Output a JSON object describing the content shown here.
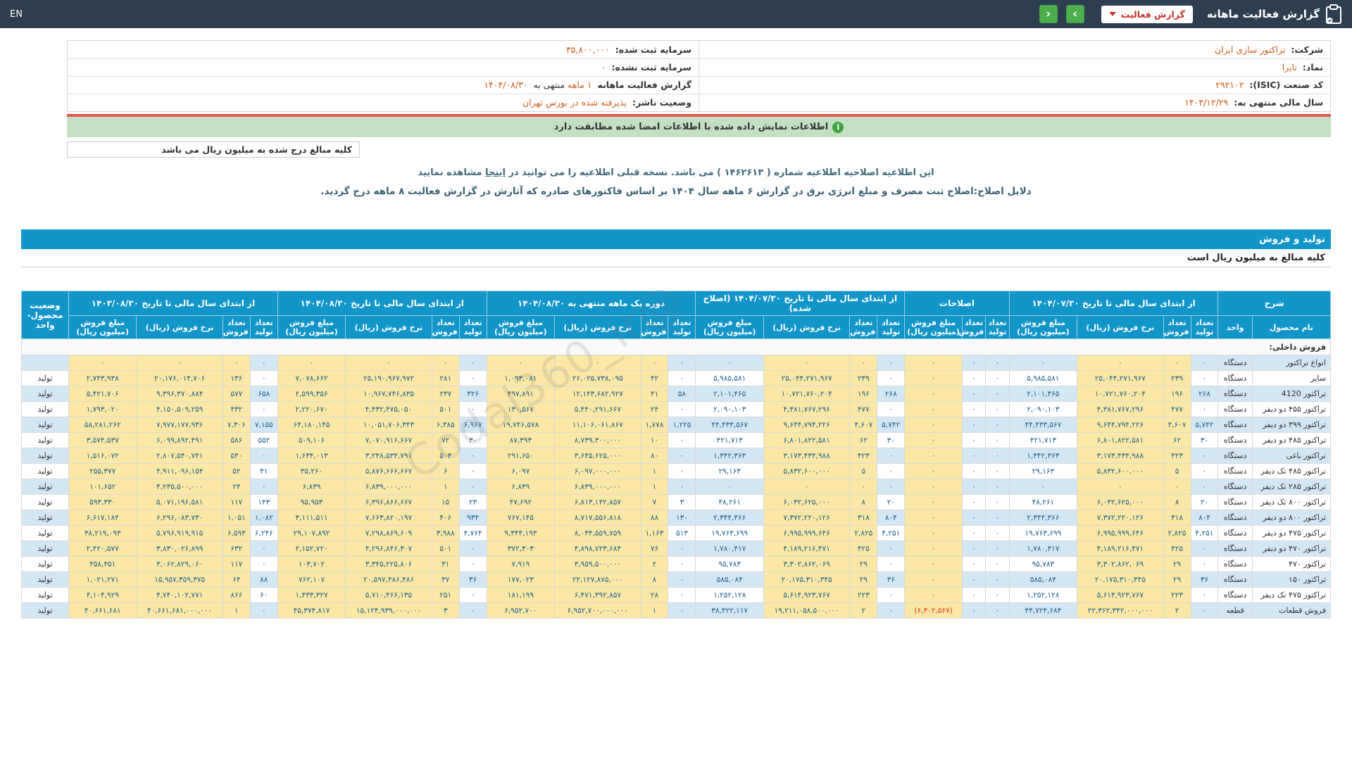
{
  "topbar": {
    "en": "EN",
    "title": "گزارش فعالیت ماهانه",
    "report_type": "گزارش فعالیت",
    "nav_prev": "‹",
    "nav_next": "›"
  },
  "info": {
    "right": [
      {
        "label": "شرکت:",
        "value": "تراکتور سازی ایران"
      },
      {
        "label": "نماد:",
        "value": "تایرا"
      },
      {
        "label": "کد صنعت (ISIC):",
        "value": "۲۹۲۱۰۲"
      },
      {
        "label": "سال مالی منتهی به:",
        "value": "۱۴۰۴/۱۲/۲۹"
      }
    ],
    "left": [
      {
        "label": "سرمایه ثبت شده:",
        "value": "۳۵,۸۰۰,۰۰۰"
      },
      {
        "label": "سرمایه ثبت نشده:",
        "value": "۰"
      },
      {
        "label": "گزارش فعالیت ماهانه",
        "value": "۱ ماهه",
        "suffix": "منتهی به",
        "value2": "۱۴۰۴/۰۸/۳۰"
      },
      {
        "label": "وضعیت ناشر:",
        "value": "پذیرفته شده در بورس تهران"
      }
    ]
  },
  "notice": "اطلاعات نمایش داده شده با اطلاعات امضا شده مطابقت دارد",
  "notice_icon": "i",
  "amounts_note": "کلیه مبالغ درج شده به میلیون ریال می باشد",
  "amendment_line": {
    "pre": "این اطلاعیه اصلاحیه اطلاعیه شماره ( ۱۴۶۲۶۱۳ ) می باشد. نسخه قبلی اطلاعیه را می توانید در",
    "link": "اینجا",
    "post": "مشاهده نمایید"
  },
  "reason_line": "دلایل اصلاح:اصلاح ثبت مصرف و مبلغ انرژی برق در گزارش ۶ ماهه سال ۱۴۰۴ بر اساس فاکتورهای صادره که آثارش در گزارش فعالیت ۸ ماهه درج گردید.",
  "section_bar": "تولید و فروش",
  "table_note": "کلیه مبالغ به میلیون ریال است",
  "watermark": "@Codal360_ir",
  "table": {
    "groups": [
      {
        "label": "شرح",
        "cols": 2
      },
      {
        "label": "از ابتدای سال مالی تا تاریخ ۱۴۰۴/۰۷/۳۰",
        "cols": 4
      },
      {
        "label": "اصلاحات",
        "cols": 3
      },
      {
        "label": "از ابتدای سال مالی تا تاریخ ۱۴۰۴/۰۷/۳۰ (اصلاح شده)",
        "cols": 4
      },
      {
        "label": "دوره یک ماهه منتهی به ۱۴۰۴/۰۸/۳۰",
        "cols": 4
      },
      {
        "label": "از ابتدای سال مالی تا تاریخ ۱۴۰۴/۰۸/۳۰",
        "cols": 4
      },
      {
        "label": "از ابتدای سال مالی تا تاریخ ۱۴۰۳/۰۸/۳۰",
        "cols": 4
      },
      {
        "label": "وضعیت محصول- واحد",
        "cols": 1,
        "rowspan": 2
      }
    ],
    "sub": {
      "name": "نام محصول",
      "unit": "واحد",
      "prod": "تعداد تولید",
      "sold": "تعداد فروش",
      "rate": "نرخ فروش (ریال)",
      "amount": "مبلغ فروش (میلیون ریال)"
    },
    "section_row": "فروش داخلی:",
    "rows": [
      {
        "name": "انواع تراکتور",
        "unit": "دستگاه",
        "status": "",
        "y1404_07": [
          "۰",
          "۰",
          "۰",
          "۰"
        ],
        "amend": [
          "۰",
          "۰",
          "۰"
        ],
        "corrected": [
          "۰",
          "۰",
          "۰",
          "۰"
        ],
        "month": [
          "۰",
          "۰",
          "۰",
          "۰"
        ],
        "y1404_08": [
          "۰",
          "۰",
          "۰",
          "۰"
        ],
        "y1403_08": [
          "۰",
          "۰",
          "۰",
          "۰"
        ]
      },
      {
        "name": "سایر",
        "unit": "دستگاه",
        "status": "تولید",
        "y1404_07": [
          "۰",
          "۲۳۹",
          "۲۵,۰۴۴,۲۷۱,۹۶۷",
          "۵,۹۸۵,۵۸۱"
        ],
        "amend": [
          "۰",
          "۰",
          "۰"
        ],
        "corrected": [
          "۰",
          "۲۳۹",
          "۲۵,۰۴۴,۲۷۱,۹۶۷",
          "۵,۹۸۵,۵۸۱"
        ],
        "month": [
          "۰",
          "۴۲",
          "۲۶,۰۲۵,۷۳۸,۰۹۵",
          "۱,۰۹۳,۰۸۱"
        ],
        "y1404_08": [
          "۰",
          "۲۸۱",
          "۲۵,۱۹۰,۹۶۷,۹۷۲",
          "۷,۰۷۸,۶۶۲"
        ],
        "y1403_08": [
          "۰",
          "۱۳۶",
          "۲۰,۱۷۶,۰۱۴,۷۰۶",
          "۲,۷۴۳,۹۳۸"
        ]
      },
      {
        "name": "تراکتور 4120",
        "unit": "دستگاه",
        "status": "تولید",
        "y1404_07": [
          "۲۶۸",
          "۱۹۶",
          "۱۰,۷۲۱,۷۶۰,۲۰۴",
          "۲,۱۰۱,۴۶۵"
        ],
        "amend": [
          "۰",
          "۰",
          "۰"
        ],
        "corrected": [
          "۲۶۸",
          "۱۹۶",
          "۱۰,۷۲۱,۷۶۰,۲۰۴",
          "۲,۱۰۱,۴۶۵"
        ],
        "month": [
          "۵۸",
          "۴۱",
          "۱۲,۱۴۳,۶۸۲,۹۲۷",
          "۴۹۷,۸۹۱"
        ],
        "y1404_08": [
          "۳۲۶",
          "۲۳۷",
          "۱۰,۹۶۷,۷۴۶,۸۳۵",
          "۲,۵۹۹,۳۵۶"
        ],
        "y1403_08": [
          "۶۵۸",
          "۵۷۷",
          "۹,۳۹۶,۳۷۰,۸۸۴",
          "۵,۴۲۱,۷۰۶"
        ]
      },
      {
        "name": "تراکتور ۴۵۵ دو دیفر",
        "unit": "دستگاه",
        "status": "تولید",
        "y1404_07": [
          "۰",
          "۴۷۷",
          "۴,۳۸۱,۷۶۷,۲۹۶",
          "۲,۰۹۰,۱۰۳"
        ],
        "amend": [
          "۰",
          "۰",
          "۰"
        ],
        "corrected": [
          "۰",
          "۴۷۷",
          "۴,۳۸۱,۷۶۷,۲۹۶",
          "۲,۰۹۰,۱۰۳"
        ],
        "month": [
          "۰",
          "۲۴",
          "۵,۴۴۰,۲۹۱,۶۶۷",
          "۱۳۰,۵۶۷"
        ],
        "y1404_08": [
          "۰",
          "۵۰۱",
          "۴,۴۳۲,۴۷۵,۰۵۰",
          "۲,۲۲۰,۶۷۰"
        ],
        "y1403_08": [
          "۰",
          "۴۳۲",
          "۴,۱۵۰,۵۰۹,۲۵۹",
          "۱,۷۹۳,۰۲۰"
        ]
      },
      {
        "name": "تراکتور ۳۹۹ دو دیفر",
        "unit": "دستگاه",
        "status": "تولید",
        "y1404_07": [
          "۵,۷۴۲",
          "۴,۶۰۷",
          "۹,۶۴۴,۷۹۴,۲۲۶",
          "۴۴,۴۳۳,۵۶۷"
        ],
        "amend": [
          "۰",
          "۰",
          "۰"
        ],
        "corrected": [
          "۵,۷۴۲",
          "۴,۶۰۷",
          "۹,۶۴۴,۷۹۴,۲۲۶",
          "۴۴,۴۳۳,۵۶۷"
        ],
        "month": [
          "۱,۲۲۵",
          "۱,۷۷۸",
          "۱۱,۱۰۶,۰۶۱,۸۶۷",
          "۱۹,۷۴۶,۵۷۸"
        ],
        "y1404_08": [
          "۶,۹۶۷",
          "۶,۳۸۵",
          "۱۰,۰۵۱,۷۰۶,۳۴۳",
          "۶۴,۱۸۰,۱۴۵"
        ],
        "y1403_08": [
          "۷,۱۵۵",
          "۷,۳۰۶",
          "۷,۹۷۷,۱۷۷,۹۳۶",
          "۵۸,۲۸۱,۲۶۲"
        ]
      },
      {
        "name": "تراکتور ۴۸۵ دو دیفر",
        "unit": "دستگاه",
        "status": "تولید",
        "y1404_07": [
          "۳۰",
          "۶۲",
          "۶,۸۰۱,۸۲۲,۵۸۱",
          "۴۲۱,۷۱۳"
        ],
        "amend": [
          "۰",
          "۰",
          "۰"
        ],
        "corrected": [
          "۳۰",
          "۶۲",
          "۶,۸۰۱,۸۲۲,۵۸۱",
          "۴۲۱,۷۱۳"
        ],
        "month": [
          "۰",
          "۱۰",
          "۸,۷۳۹,۳۰۰,۰۰۰",
          "۸۷,۳۹۳"
        ],
        "y1404_08": [
          "۳۰",
          "۷۲",
          "۷,۰۷۰,۹۱۶,۶۶۷",
          "۵۰۹,۱۰۶"
        ],
        "y1403_08": [
          "۵۵۲",
          "۵۸۶",
          "۶,۰۹۹,۸۹۲,۴۹۱",
          "۳,۵۷۴,۵۳۷"
        ]
      },
      {
        "name": "تراکتور باغی",
        "unit": "دستگاه",
        "status": "تولید",
        "y1404_07": [
          "۰",
          "۴۲۳",
          "۳,۱۷۳,۴۳۴,۹۸۸",
          "۱,۳۴۲,۳۶۳"
        ],
        "amend": [
          "۰",
          "۰",
          "۰"
        ],
        "corrected": [
          "۰",
          "۴۲۳",
          "۳,۱۷۳,۴۳۴,۹۸۸",
          "۱,۳۴۲,۳۶۳"
        ],
        "month": [
          "۰",
          "۸۰",
          "۳,۶۴۵,۶۲۵,۰۰۰",
          "۲۹۱,۶۵۰"
        ],
        "y1404_08": [
          "۰",
          "۵۰۳",
          "۳,۲۴۸,۵۳۴,۷۹۱",
          "۱,۶۳۴,۰۱۳"
        ],
        "y1403_08": [
          "۰",
          "۵۴۰",
          "۲,۸۰۷,۵۴۰,۷۴۱",
          "۱,۵۱۶,۰۷۲"
        ]
      },
      {
        "name": "تراکتور ۴۸۵ تک دیفر",
        "unit": "دستگاه",
        "status": "تولید",
        "y1404_07": [
          "۰",
          "۵",
          "۵,۸۳۲,۶۰۰,۰۰۰",
          "۲۹,۱۶۳"
        ],
        "amend": [
          "۰",
          "۰",
          "۰"
        ],
        "corrected": [
          "۰",
          "۵",
          "۵,۸۳۲,۶۰۰,۰۰۰",
          "۲۹,۱۶۳"
        ],
        "month": [
          "۰",
          "۱",
          "۶,۰۹۷,۰۰۰,۰۰۰",
          "۶,۰۹۷"
        ],
        "y1404_08": [
          "۰",
          "۶",
          "۵,۸۷۶,۶۶۶,۶۶۷",
          "۳۵,۲۶۰"
        ],
        "y1403_08": [
          "۴۱",
          "۵۲",
          "۴,۹۱۱,۰۹۶,۱۵۴",
          "۲۵۵,۳۷۷"
        ]
      },
      {
        "name": "تراکتور ۲۸۵ تک دیفر",
        "unit": "دستگاه",
        "status": "تولید",
        "y1404_07": [
          "۰",
          "۰",
          "۰",
          "۰"
        ],
        "amend": [
          "۰",
          "۰",
          "۰"
        ],
        "corrected": [
          "۰",
          "۰",
          "۰",
          "۰"
        ],
        "month": [
          "۰",
          "۱",
          "۶,۸۳۹,۰۰۰,۰۰۰",
          "۶,۸۳۹"
        ],
        "y1404_08": [
          "۰",
          "۱",
          "۶,۸۳۹,۰۰۰,۰۰۰",
          "۶,۸۳۹"
        ],
        "y1403_08": [
          "۰",
          "۲۴",
          "۴,۲۳۵,۵۰۰,۰۰۰",
          "۱۰۱,۶۵۲"
        ]
      },
      {
        "name": "تراکتور ۸۰۰ تک دیفر",
        "unit": "دستگاه",
        "status": "تولید",
        "y1404_07": [
          "۲۰",
          "۸",
          "۶,۰۳۲,۶۲۵,۰۰۰",
          "۴۸,۲۶۱"
        ],
        "amend": [
          "۰",
          "۰",
          "۰"
        ],
        "corrected": [
          "۲۰",
          "۸",
          "۶,۰۳۲,۶۲۵,۰۰۰",
          "۴۸,۲۶۱"
        ],
        "month": [
          "۳",
          "۷",
          "۶,۸۱۳,۱۴۲,۸۵۷",
          "۴۷,۶۹۲"
        ],
        "y1404_08": [
          "۲۳",
          "۱۵",
          "۶,۳۹۶,۸۶۶,۶۶۷",
          "۹۵,۹۵۳"
        ],
        "y1403_08": [
          "۱۴۳",
          "۱۱۷",
          "۵,۰۷۱,۱۹۶,۵۸۱",
          "۵۹۳,۳۳۰"
        ]
      },
      {
        "name": "تراکتور ۸۰۰ دو دیفر",
        "unit": "دستگاه",
        "status": "تولید",
        "y1404_07": [
          "۸۰۴",
          "۳۱۸",
          "۷,۳۷۲,۲۲۰,۱۲۶",
          "۲,۳۴۴,۳۶۶"
        ],
        "amend": [
          "۰",
          "۰",
          "۰"
        ],
        "corrected": [
          "۸۰۴",
          "۳۱۸",
          "۷,۳۷۲,۲۲۰,۱۲۶",
          "۲,۳۴۴,۳۶۶"
        ],
        "month": [
          "۱۳۰",
          "۸۸",
          "۸,۷۱۷,۵۵۶,۸۱۸",
          "۷۶۷,۱۴۵"
        ],
        "y1404_08": [
          "۹۳۴",
          "۴۰۶",
          "۷,۶۶۳,۸۲۰,۱۹۷",
          "۳,۱۱۱,۵۱۱"
        ],
        "y1403_08": [
          "۱,۰۸۲",
          "۱,۰۵۱",
          "۶,۲۹۶,۰۸۳,۷۳۰",
          "۶,۶۱۷,۱۸۴"
        ]
      },
      {
        "name": "تراکتور ۴۷۵ دو دیفر",
        "unit": "دستگاه",
        "status": "تولید",
        "y1404_07": [
          "۴,۲۵۱",
          "۲,۸۲۵",
          "۶,۹۹۵,۹۹۹,۶۴۶",
          "۱۹,۷۶۳,۶۹۹"
        ],
        "amend": [
          "۰",
          "۰",
          "۰"
        ],
        "corrected": [
          "۴,۲۵۱",
          "۲,۸۲۵",
          "۶,۹۹۵,۹۹۹,۶۴۶",
          "۱۹,۷۶۳,۶۹۹"
        ],
        "month": [
          "۵۱۳",
          "۱,۱۶۳",
          "۸,۰۳۴,۵۵۹,۷۵۹",
          "۹,۳۴۴,۱۹۳"
        ],
        "y1404_08": [
          "۴,۷۶۴",
          "۳,۹۸۸",
          "۷,۲۹۸,۸۶۹,۶۰۹",
          "۲۹,۱۰۷,۸۹۲"
        ],
        "y1403_08": [
          "۶,۲۴۶",
          "۶,۵۹۳",
          "۵,۷۹۶,۹۱۹,۹۱۵",
          "۳۸,۲۱۹,۰۹۳"
        ]
      },
      {
        "name": "تراکتور ۴۷۰ دو دیفر",
        "unit": "دستگاه",
        "status": "تولید",
        "y1404_07": [
          "۰",
          "۴۲۵",
          "۴,۱۸۹,۲۱۶,۴۷۱",
          "۱,۷۸۰,۴۱۷"
        ],
        "amend": [
          "۰",
          "۰",
          "۰"
        ],
        "corrected": [
          "۰",
          "۴۲۵",
          "۴,۱۸۹,۲۱۶,۴۷۱",
          "۱,۷۸۰,۴۱۷"
        ],
        "month": [
          "۰",
          "۷۶",
          "۴,۸۹۸,۷۲۳,۶۸۴",
          "۳۷۲,۳۰۳"
        ],
        "y1404_08": [
          "۰",
          "۵۰۱",
          "۴,۲۹۶,۸۴۶,۳۰۷",
          "۲,۱۵۲,۷۲۰"
        ],
        "y1403_08": [
          "۰",
          "۶۳۲",
          "۳,۸۳۰,۰۲۶,۸۹۹",
          "۲,۴۲۰,۵۷۷"
        ]
      },
      {
        "name": "تراکتور ۴۷۰",
        "unit": "دستگاه",
        "status": "تولید",
        "y1404_07": [
          "۰",
          "۲۹",
          "۳,۳۰۲,۸۶۲,۰۶۹",
          "۹۵,۷۸۳"
        ],
        "amend": [
          "۰",
          "۰",
          "۰"
        ],
        "corrected": [
          "۰",
          "۲۹",
          "۳,۳۰۲,۸۶۲,۰۶۹",
          "۹۵,۷۸۳"
        ],
        "month": [
          "۰",
          "۲",
          "۳,۹۵۹,۵۰۰,۰۰۰",
          "۷,۹۱۹"
        ],
        "y1404_08": [
          "۰",
          "۳۱",
          "۳,۳۴۵,۲۲۵,۸۰۶",
          "۱۰۳,۷۰۲"
        ],
        "y1403_08": [
          "۰",
          "۱۱۷",
          "۳,۰۶۲,۸۲۹,۰۶۰",
          "۳۵۸,۳۵۱"
        ]
      },
      {
        "name": "تراکتور ۱۵۰",
        "unit": "دستگاه",
        "status": "تولید",
        "y1404_07": [
          "۳۶",
          "۲۹",
          "۲۰,۱۷۵,۳۱۰,۳۴۵",
          "۵۸۵,۰۸۴"
        ],
        "amend": [
          "۰",
          "۰",
          "۰"
        ],
        "corrected": [
          "۳۶",
          "۲۹",
          "۲۰,۱۷۵,۳۱۰,۳۴۵",
          "۵۸۵,۰۸۴"
        ],
        "month": [
          "۰",
          "۸",
          "۲۲,۱۲۷,۸۷۵,۰۰۰",
          "۱۷۷,۰۲۳"
        ],
        "y1404_08": [
          "۳۶",
          "۳۷",
          "۲۰,۵۹۷,۴۸۶,۴۸۶",
          "۷۶۲,۱۰۷"
        ],
        "y1403_08": [
          "۸۸",
          "۶۴",
          "۱۵,۹۵۷,۳۵۹,۳۷۵",
          "۱,۰۲۱,۲۷۱"
        ]
      },
      {
        "name": "تراکتور ۴۷۵ تک دیفر",
        "unit": "دستگاه",
        "status": "تولید",
        "y1404_07": [
          "۰",
          "۲۲۳",
          "۵,۶۱۴,۹۲۳,۷۶۷",
          "۱,۲۵۲,۱۲۸"
        ],
        "amend": [
          "۰",
          "۰",
          "۰"
        ],
        "corrected": [
          "۰",
          "۲۲۳",
          "۵,۶۱۴,۹۲۳,۷۶۷",
          "۱,۲۵۲,۱۲۸"
        ],
        "month": [
          "۰",
          "۲۸",
          "۶,۴۷۱,۳۹۲,۸۵۷",
          "۱۸۱,۱۹۹"
        ],
        "y1404_08": [
          "۰",
          "۲۵۱",
          "۵,۷۱۰,۴۶۶,۱۳۵",
          "۱,۴۳۳,۳۲۷"
        ],
        "y1403_08": [
          "۶۰",
          "۸۶۶",
          "۴,۷۴۰,۱۰۲,۷۷۱",
          "۴,۱۰۴,۹۲۹"
        ]
      },
      {
        "name": "فروش قطعات",
        "unit": "قطعه",
        "status": "تولید",
        "y1404_07": [
          "۰",
          "۲",
          "۲۲,۳۶۲,۳۴۲,۰۰۰,۰۰۰",
          "۴۴,۷۲۴,۶۸۴"
        ],
        "amend": [
          "۰",
          "۰",
          "(۶,۳۰۲,۵۶۷)"
        ],
        "corrected": [
          "۰",
          "۲",
          "۱۹,۲۱۱,۰۵۸,۵۰۰,۰۰۰",
          "۳۸,۴۲۲,۱۱۷"
        ],
        "month": [
          "۰",
          "۱",
          "۶,۹۵۲,۷۰۰,۰۰۰,۰۰۰",
          "۶,۹۵۲,۷۰۰"
        ],
        "y1404_08": [
          "۰",
          "۳",
          "۱۵,۱۲۴,۹۳۹,۰۰۰,۰۰۰",
          "۴۵,۳۷۴,۸۱۷"
        ],
        "y1403_08": [
          "۰",
          "۱",
          "۴۰,۶۶۱,۶۸۱,۰۰۰,۰۰۰",
          "۴۰,۶۶۱,۶۸۱"
        ]
      }
    ]
  }
}
